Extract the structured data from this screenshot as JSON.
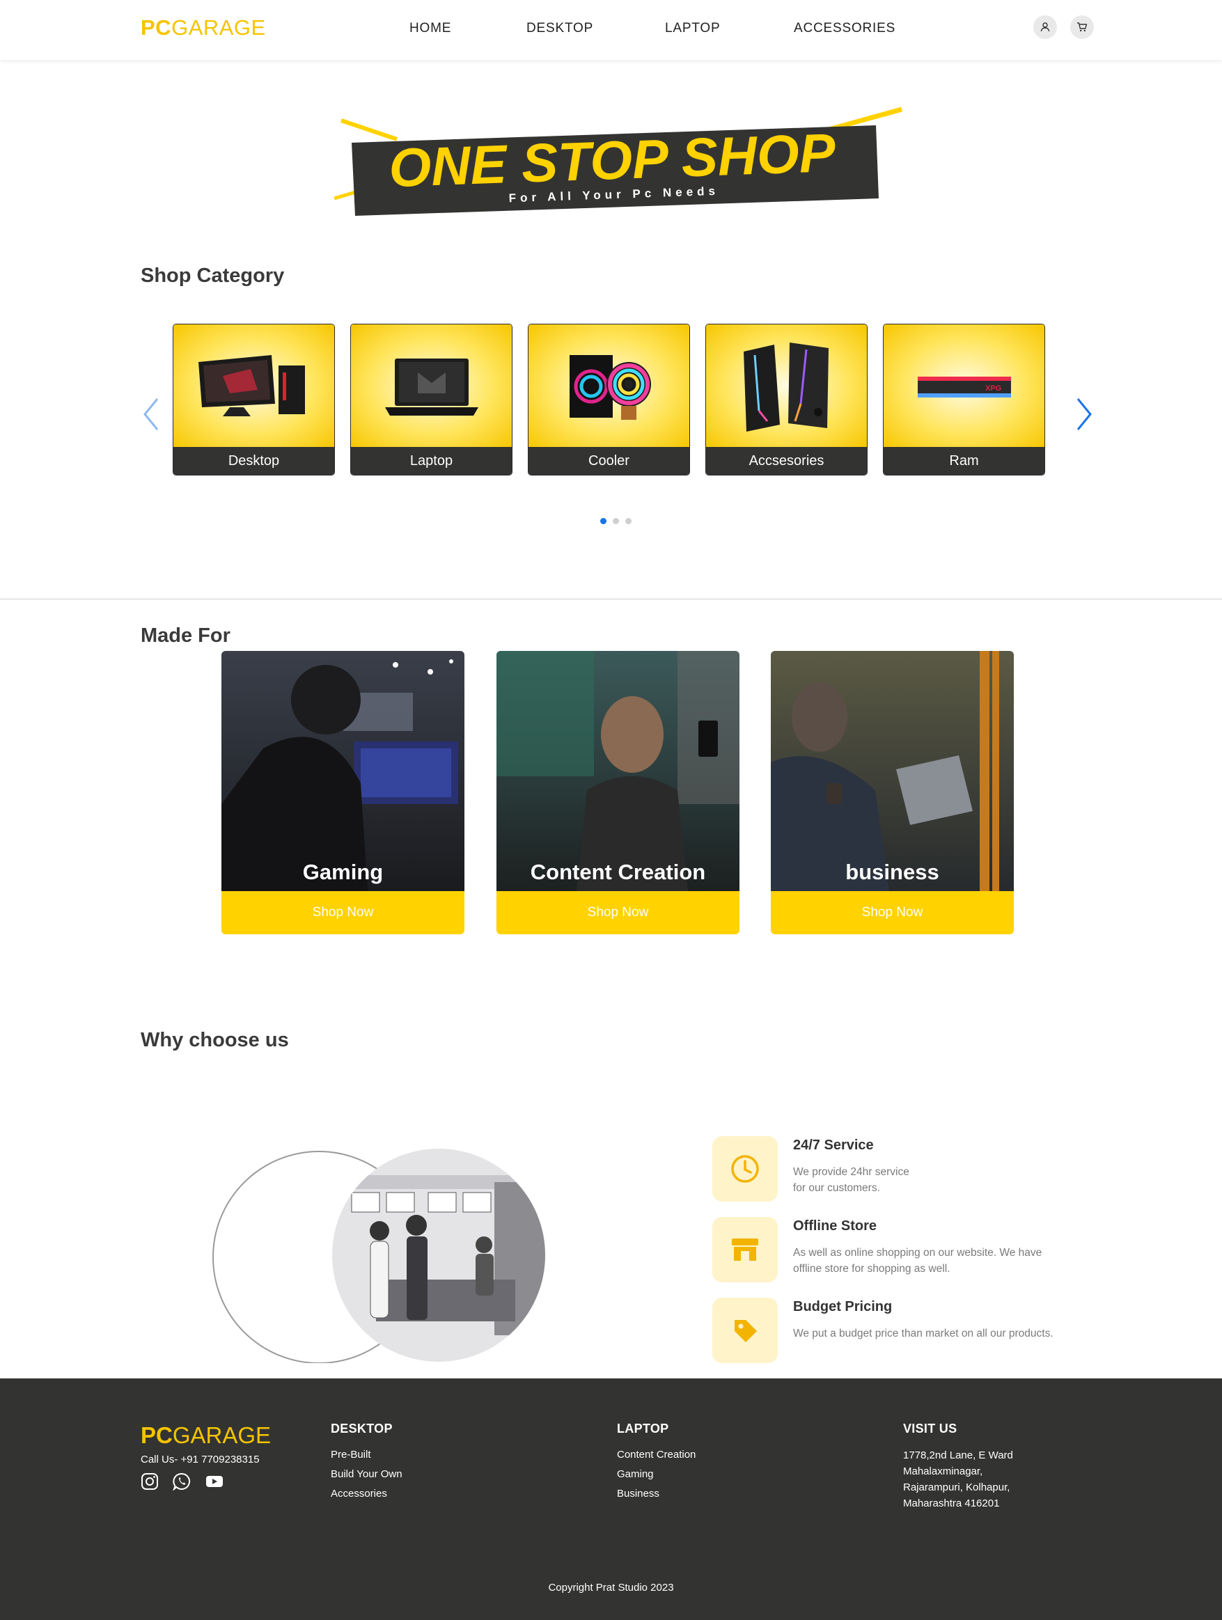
{
  "header": {
    "logo_pc": "PC",
    "logo_garage": "GARAGE",
    "nav": [
      "HOME",
      "DESKTOP",
      "LAPTOP",
      "ACCESSORIES"
    ],
    "icons": [
      "user-icon",
      "cart-icon"
    ]
  },
  "banner": {
    "headline": "ONE STOP SHOP",
    "tagline": "For All Your Pc Needs"
  },
  "shop_category": {
    "title": "Shop Category",
    "items": [
      "Desktop",
      "Laptop",
      "Cooler",
      "Accsesories",
      "Ram"
    ],
    "carousel_pages": 3,
    "active_page": 1
  },
  "made_for": {
    "title": "Made For",
    "cards": [
      {
        "title": "Gaming",
        "button": "Shop Now"
      },
      {
        "title": "Content Creation",
        "button": "Shop Now"
      },
      {
        "title": "business",
        "button": "Shop Now"
      }
    ]
  },
  "why_choose_us": {
    "title": "Why choose us",
    "features": [
      {
        "icon": "clock-icon",
        "title": "24/7 Service",
        "desc_lines": [
          "We provide 24hr service",
          "for our customers."
        ]
      },
      {
        "icon": "store-icon",
        "title": "Offline Store",
        "desc_lines": [
          "As well as online shopping on our website. We have",
          "offline store for shopping as well."
        ]
      },
      {
        "icon": "tag-icon",
        "title": "Budget Pricing",
        "desc_lines": [
          "We put a budget price than market on all our products."
        ]
      }
    ]
  },
  "footer": {
    "logo_pc": "PC",
    "logo_garage": "GARAGE",
    "call": "Call Us- +91 7709238315",
    "social": [
      "instagram-icon",
      "whatsapp-icon",
      "youtube-icon"
    ],
    "columns": [
      {
        "heading": "DESKTOP",
        "links": [
          "Pre-Built",
          "Build Your Own",
          "Accessories"
        ]
      },
      {
        "heading": "LAPTOP",
        "links": [
          "Content Creation",
          "Gaming",
          "Business"
        ]
      }
    ],
    "visit_heading": "VISIT US",
    "address_lines": [
      "1778,2nd Lane, E Ward",
      "Mahalaxminagar,",
      "Rajarampuri, Kolhapur,",
      "Maharashtra 416201"
    ],
    "copyright": "Copyright Prat Studio 2023"
  },
  "colors": {
    "brand_yellow": "#ffd200",
    "dark": "#333432",
    "accent_blue": "#1a73e8"
  }
}
